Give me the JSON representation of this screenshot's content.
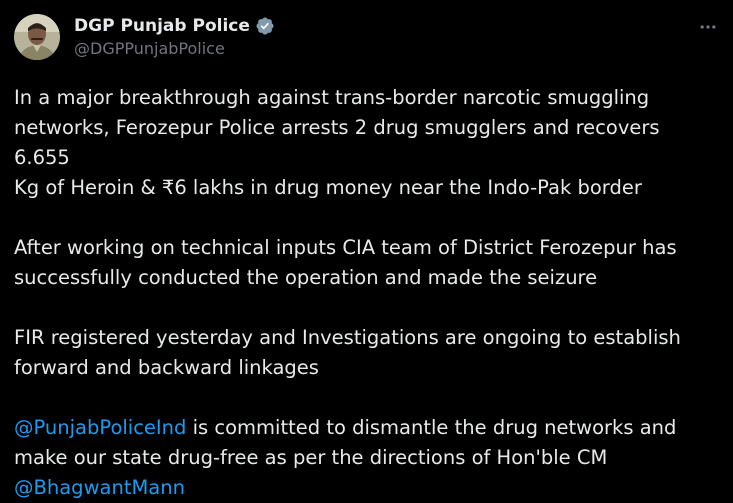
{
  "author": {
    "display_name": "DGP Punjab Police",
    "handle": "@DGPPunjabPolice",
    "verified": true,
    "verified_badge_color": "#829aab"
  },
  "more_icon": "more-horizontal-icon",
  "colors": {
    "background": "#000000",
    "text": "#e7e9ea",
    "secondary": "#71767b",
    "link": "#1d9bf0"
  },
  "tweet": {
    "para1": "In a major breakthrough against trans-border narcotic smuggling\nnetworks, Ferozepur Police arrests 2 drug smugglers and recovers 6.655\nKg of Heroin & ₹6 lakhs in drug money near the Indo-Pak border",
    "para2": "After working on technical inputs  CIA team of District Ferozepur has\nsuccessfully conducted the operation and made the seizure",
    "para3": "FIR  registered yesterday and Investigations are ongoing to establish\nforward and backward linkages",
    "para4": {
      "mention1": "@PunjabPoliceInd",
      "text1": " is committed to dismantle the drug networks and\nmake our state drug-free as per the directions of Hon'ble CM\n",
      "mention2": "@BhagwantMann"
    }
  }
}
